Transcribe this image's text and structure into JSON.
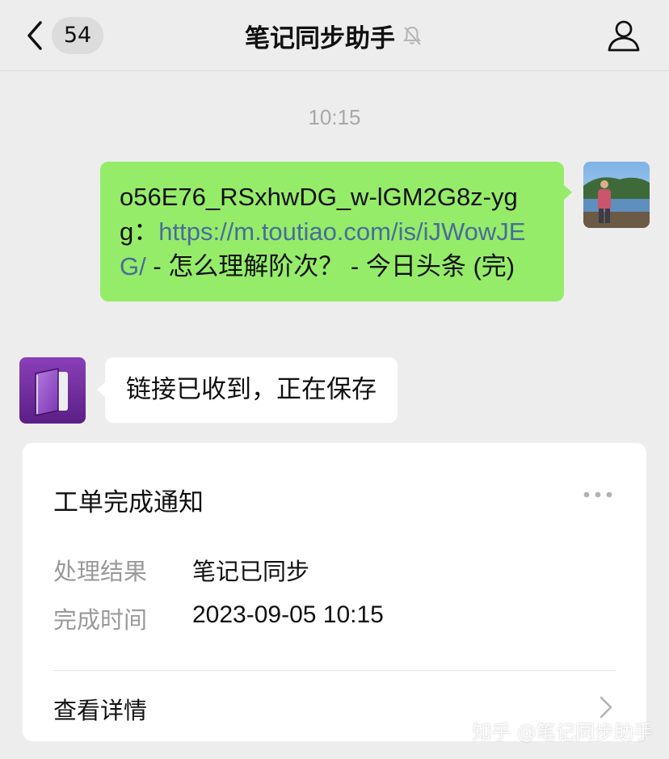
{
  "header": {
    "back_label": "Back",
    "unread_count": "54",
    "title": "笔记同步助手",
    "muted": true
  },
  "chat": {
    "timestamp": "10:15",
    "sent_message": {
      "prefix": "o56E76_RSxhwDG_w-lGM2G8z-ygg：",
      "link": "https://m.toutiao.com/is/iJWowJEG/",
      "suffix": " - 怎么理解阶次？ - 今日头条 (完)"
    },
    "received_message": "链接已收到，正在保存"
  },
  "card": {
    "title": "工单完成通知",
    "rows": [
      {
        "label": "处理结果",
        "value": "笔记已同步"
      },
      {
        "label": "完成时间",
        "value": "2023-09-05 10:15"
      }
    ],
    "detail_label": "查看详情"
  },
  "watermark": "知乎 @笔记同步助手",
  "colors": {
    "background": "#ededed",
    "sent_bubble": "#95ec69",
    "received_bubble": "#ffffff",
    "link": "#4a6c9b",
    "muted_text": "#9a9a9a"
  }
}
